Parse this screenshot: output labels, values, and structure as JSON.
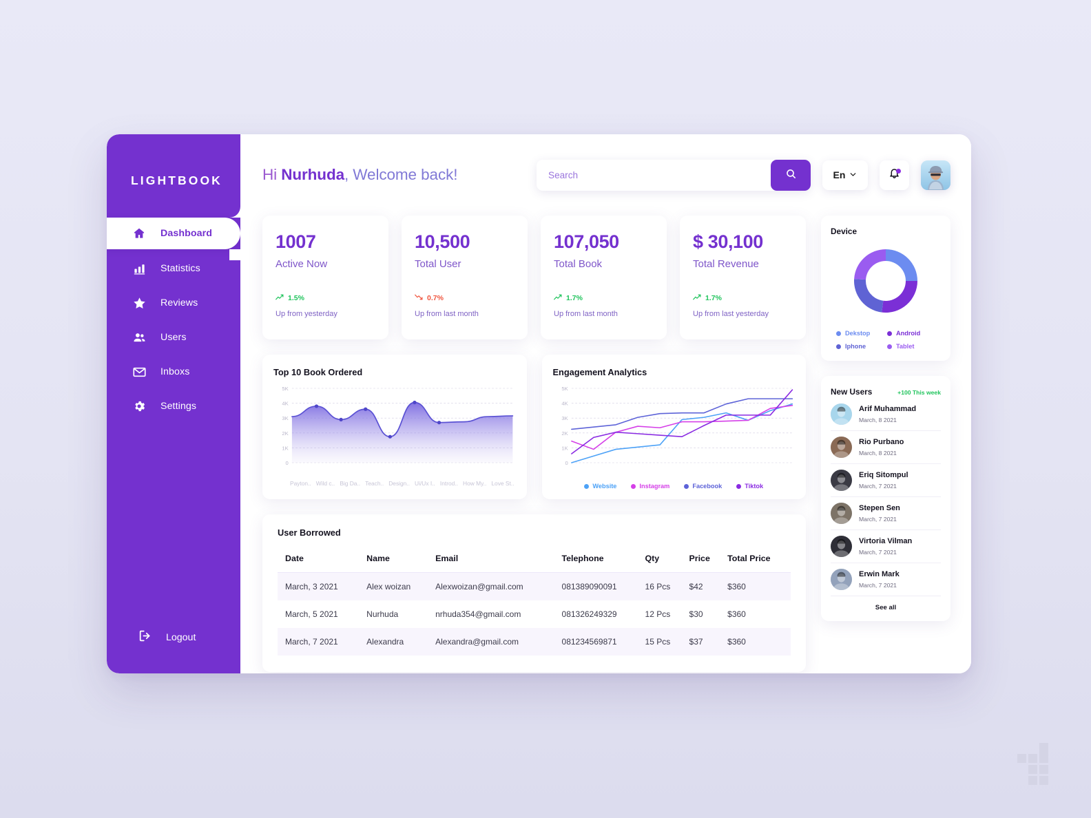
{
  "brand": {
    "name": "LIGHTBOOK"
  },
  "sidebar": {
    "items": [
      {
        "label": "Dashboard",
        "icon": "home-icon",
        "active": true
      },
      {
        "label": "Statistics",
        "icon": "bar-chart-icon",
        "active": false
      },
      {
        "label": "Reviews",
        "icon": "star-icon",
        "active": false
      },
      {
        "label": "Users",
        "icon": "users-icon",
        "active": false
      },
      {
        "label": "Inboxs",
        "icon": "envelope-icon",
        "active": false
      },
      {
        "label": "Settings",
        "icon": "gear-icon",
        "active": false
      }
    ],
    "logout": {
      "label": "Logout",
      "icon": "logout-icon"
    }
  },
  "header": {
    "greeting_hi": "Hi ",
    "greeting_name": "Nurhuda",
    "greeting_rest": ", Welcome back!",
    "search_placeholder": "Search",
    "search_value": "",
    "search_icon": "search-icon",
    "language": "En",
    "chevron_icon": "chevron-down-icon",
    "bell_icon": "bell-icon",
    "avatar": "user-avatar"
  },
  "stats": [
    {
      "value": "1007",
      "label": "Active Now",
      "delta": "1.5%",
      "direction": "up",
      "note": "Up from yesterday"
    },
    {
      "value": "10,500",
      "label": "Total User",
      "delta": "0.7%",
      "direction": "down",
      "note": "Up from last month"
    },
    {
      "value": "107,050",
      "label": "Total Book",
      "delta": "1.7%",
      "direction": "up",
      "note": "Up from last month"
    },
    {
      "value": "$ 30,100",
      "label": "Total Revenue",
      "delta": "1.7%",
      "direction": "up",
      "note": "Up from last yesterday"
    }
  ],
  "table": {
    "title": "User Borrowed",
    "columns": [
      "Date",
      "Name",
      "Email",
      "Telephone",
      "Qty",
      "Price",
      "Total Price"
    ],
    "rows": [
      [
        "March, 3 2021",
        "Alex woizan",
        "Alexwoizan@gmail.com",
        "081389090091",
        "16 Pcs",
        "$42",
        "$360"
      ],
      [
        "March, 5 2021",
        "Nurhuda",
        "nrhuda354@gmail.com",
        "081326249329",
        "12 Pcs",
        "$30",
        "$360"
      ],
      [
        "March, 7 2021",
        "Alexandra",
        "Alexandra@gmail.com",
        "081234569871",
        "15 Pcs",
        "$37",
        "$360"
      ]
    ]
  },
  "device": {
    "title": "Device"
  },
  "new_users": {
    "title": "New Users",
    "badge": "+100 This week",
    "see_all": "See all",
    "items": [
      {
        "name": "Arif Muhammad",
        "date": "March, 8 2021",
        "avatar_color": "#a8d6ec"
      },
      {
        "name": "Rio Purbano",
        "date": "March, 8 2021",
        "avatar_color": "#8a6a55"
      },
      {
        "name": "Eriq Sitompul",
        "date": "March, 7 2021",
        "avatar_color": "#3a3a44"
      },
      {
        "name": "Stepen Sen",
        "date": "March, 7 2021",
        "avatar_color": "#7d7367"
      },
      {
        "name": "Virtoria Vilman",
        "date": "March, 7 2021",
        "avatar_color": "#2e2e36"
      },
      {
        "name": "Erwin Mark",
        "date": "March, 7 2021",
        "avatar_color": "#93a2bb"
      }
    ]
  },
  "colors": {
    "brand_purple": "#7431cf",
    "accent_violet": "#5b52d4",
    "up_green": "#21c45d",
    "down_red": "#f0563f",
    "website_blue": "#4da2f7",
    "instagram_magenta": "#d540e8",
    "facebook_indigo": "#5d63d8",
    "tiktok_purple": "#8a2be2",
    "device_desktop": "#6c8cf0",
    "device_android": "#7b2fd6",
    "device_iphone": "#5f63d4",
    "device_tablet": "#9a5cf0"
  },
  "chart_data": [
    {
      "id": "top10-book-ordered",
      "type": "area",
      "title": "Top 10 Book Ordered",
      "xlabel": "",
      "ylabel": "",
      "ylim": [
        0,
        5000
      ],
      "yticks": [
        "0",
        "1K",
        "2K",
        "3K",
        "4K",
        "5K"
      ],
      "ytick_values": [
        0,
        1000,
        2000,
        3000,
        4000,
        5000
      ],
      "grid": true,
      "legend": "none",
      "categories": [
        "Payton..",
        "Wild c..",
        "Big Da..",
        "Teach..",
        "Design..",
        "Ui/Ux I..",
        "Introd..",
        "How My..",
        "Love St..",
        ""
      ],
      "values": [
        3100,
        3800,
        2900,
        3600,
        1750,
        4050,
        2700,
        2750,
        3100,
        3150
      ],
      "markers": [
        false,
        true,
        true,
        true,
        true,
        true,
        true,
        false,
        false,
        false
      ],
      "line_color": "#5b52d4",
      "fill": "gradient purple to transparent"
    },
    {
      "id": "engagement-analytics",
      "type": "line",
      "title": "Engagement Analytics",
      "xlabel": "",
      "ylabel": "",
      "ylim": [
        0,
        5000
      ],
      "yticks": [
        "0",
        "1K",
        "2K",
        "3K",
        "4K",
        "5K"
      ],
      "ytick_values": [
        0,
        1000,
        2000,
        3000,
        4000,
        5000
      ],
      "grid": true,
      "legend": "bottom",
      "x": [
        0,
        1,
        2,
        3,
        4,
        5,
        6,
        7,
        8,
        9,
        10
      ],
      "series": [
        {
          "name": "Website",
          "color": "#4da2f7",
          "values": [
            0,
            450,
            900,
            1050,
            1200,
            2900,
            3050,
            3350,
            2850,
            3500,
            3950
          ]
        },
        {
          "name": "Instagram",
          "color": "#d540e8",
          "values": [
            1450,
            900,
            2050,
            2450,
            2350,
            2750,
            2750,
            2800,
            2850,
            3650,
            3850
          ]
        },
        {
          "name": "Facebook",
          "color": "#5d63d8",
          "values": [
            2250,
            2400,
            2550,
            3050,
            3300,
            3350,
            3350,
            3950,
            4300,
            4300,
            4300
          ]
        },
        {
          "name": "Tiktok",
          "color": "#8a2be2",
          "values": [
            600,
            1700,
            2050,
            1950,
            1850,
            1750,
            2500,
            3200,
            3200,
            3200,
            4900
          ]
        }
      ]
    },
    {
      "id": "device-donut",
      "type": "pie",
      "title": "Device",
      "labels": [
        "Dekstop",
        "Android",
        "Iphone",
        "Tablet"
      ],
      "values": [
        25,
        27,
        24,
        24
      ],
      "colors": [
        "#6c8cf0",
        "#7b2fd6",
        "#5f63d4",
        "#9a5cf0"
      ],
      "legend": "bottom",
      "donut": true
    }
  ]
}
